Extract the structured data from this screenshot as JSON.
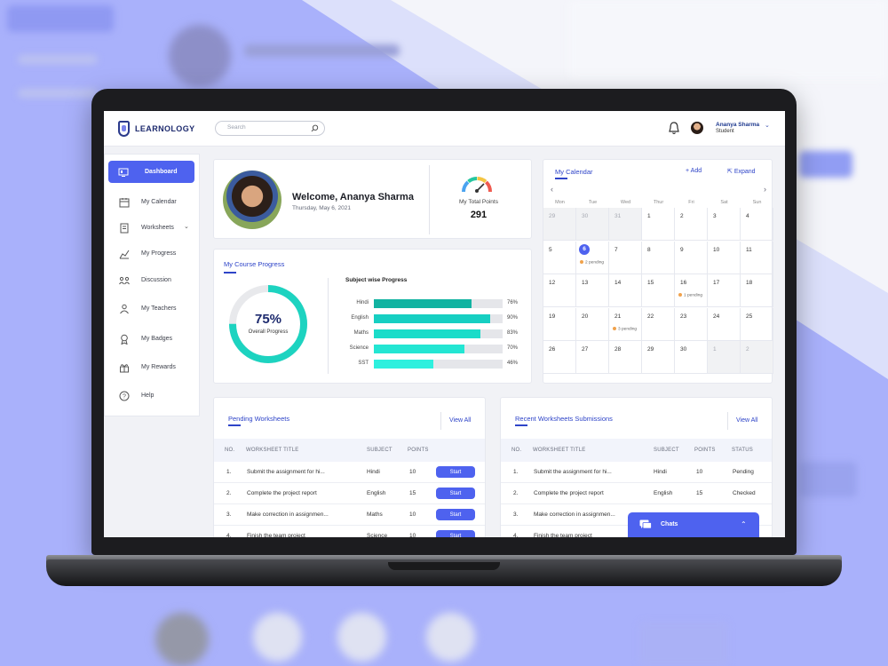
{
  "app": {
    "brand": "LEARNOLOGY"
  },
  "search": {
    "placeholder": "Search"
  },
  "user": {
    "name": "Ananya Sharma",
    "role": "Student"
  },
  "sidebar": {
    "items": [
      {
        "label": "Dashboard",
        "icon": "dashboard-icon",
        "active": true
      },
      {
        "label": "My Calendar",
        "icon": "calendar-icon"
      },
      {
        "label": "Worksheets",
        "icon": "worksheet-icon"
      },
      {
        "label": "My Progress",
        "icon": "progress-icon"
      },
      {
        "label": "Discussion",
        "icon": "discussion-icon"
      },
      {
        "label": "My Teachers",
        "icon": "teacher-icon"
      },
      {
        "label": "My Badges",
        "icon": "badge-icon"
      },
      {
        "label": "My Rewards",
        "icon": "reward-icon"
      },
      {
        "label": "Help",
        "icon": "help-icon"
      }
    ]
  },
  "welcome": {
    "title": "Welcome, Ananya Sharma",
    "date": "Thursday, May 6, 2021",
    "points_label": "My Total Points",
    "points_value": "291"
  },
  "course_progress": {
    "title": "My Course Progress",
    "overall_value": "75%",
    "overall_fraction": 0.75,
    "overall_label": "Overall Progress",
    "subject_title": "Subject wise Progress",
    "subjects": [
      {
        "name": "Hindi",
        "pct": "76%",
        "value": 76,
        "color": "#11b3a1"
      },
      {
        "name": "English",
        "pct": "90%",
        "value": 90,
        "color": "#16cfc2"
      },
      {
        "name": "Maths",
        "pct": "83%",
        "value": 83,
        "color": "#1bdcc9"
      },
      {
        "name": "Science",
        "pct": "70%",
        "value": 70,
        "color": "#23e6d3"
      },
      {
        "name": "SST",
        "pct": "46%",
        "value": 46,
        "color": "#2ef0de"
      }
    ]
  },
  "calendar": {
    "title": "My Calendar",
    "add_label": "Add",
    "expand_label": "Expand",
    "days": [
      "Mon",
      "Tue",
      "Wed",
      "Thur",
      "Fri",
      "Sat",
      "Sun"
    ],
    "weeks": [
      [
        {
          "d": "29",
          "m": true
        },
        {
          "d": "30",
          "m": true
        },
        {
          "d": "31",
          "m": true
        },
        {
          "d": "1"
        },
        {
          "d": "2"
        },
        {
          "d": "3"
        },
        {
          "d": "4"
        }
      ],
      [
        {
          "d": "5"
        },
        {
          "d": "6",
          "today": true,
          "note": "2 pending"
        },
        {
          "d": "7"
        },
        {
          "d": "8"
        },
        {
          "d": "9"
        },
        {
          "d": "10"
        },
        {
          "d": "11"
        }
      ],
      [
        {
          "d": "12"
        },
        {
          "d": "13"
        },
        {
          "d": "14"
        },
        {
          "d": "15"
        },
        {
          "d": "16",
          "note": "1 pending"
        },
        {
          "d": "17"
        },
        {
          "d": "18"
        }
      ],
      [
        {
          "d": "19"
        },
        {
          "d": "20"
        },
        {
          "d": "21",
          "note": "3 pending"
        },
        {
          "d": "22"
        },
        {
          "d": "23"
        },
        {
          "d": "24"
        },
        {
          "d": "25"
        }
      ],
      [
        {
          "d": "26"
        },
        {
          "d": "27"
        },
        {
          "d": "28"
        },
        {
          "d": "29"
        },
        {
          "d": "30"
        },
        {
          "d": "1",
          "m": true
        },
        {
          "d": "2",
          "m": true
        }
      ]
    ]
  },
  "pending": {
    "title": "Pending Worksheets",
    "view_all": "View All",
    "headers": [
      "NO.",
      "WORKSHEET TITLE",
      "SUBJECT",
      "POINTS"
    ],
    "start_label": "Start",
    "rows": [
      {
        "no": "1.",
        "title": "Submit the assignment for hi...",
        "subject": "Hindi",
        "points": "10"
      },
      {
        "no": "2.",
        "title": "Complete the project report",
        "subject": "English",
        "points": "15"
      },
      {
        "no": "3.",
        "title": "Make correction in assignmen...",
        "subject": "Maths",
        "points": "10"
      },
      {
        "no": "4.",
        "title": "Finish the team project",
        "subject": "Science",
        "points": "10"
      }
    ]
  },
  "recent": {
    "title": "Recent Worksheets Submissions",
    "view_all": "View All",
    "headers": [
      "NO.",
      "WORKSHEET TITLE",
      "SUBJECT",
      "POINTS",
      "STATUS"
    ],
    "rows": [
      {
        "no": "1.",
        "title": "Submit the assignment for hi...",
        "subject": "Hindi",
        "points": "10",
        "status": "Pending"
      },
      {
        "no": "2.",
        "title": "Complete the project report",
        "subject": "English",
        "points": "15",
        "status": "Checked"
      },
      {
        "no": "3.",
        "title": "Make correction in assignmen...",
        "subject": "",
        "points": "",
        "status": ""
      },
      {
        "no": "4.",
        "title": "Finish the team project",
        "subject": "",
        "points": "",
        "status": ""
      }
    ]
  },
  "chats": {
    "label": "Chats"
  },
  "colors": {
    "accent": "#4e62ef",
    "brand": "#1d2a6e",
    "ring": "#1dd3c0",
    "pending_dot": "#f0a24c"
  }
}
